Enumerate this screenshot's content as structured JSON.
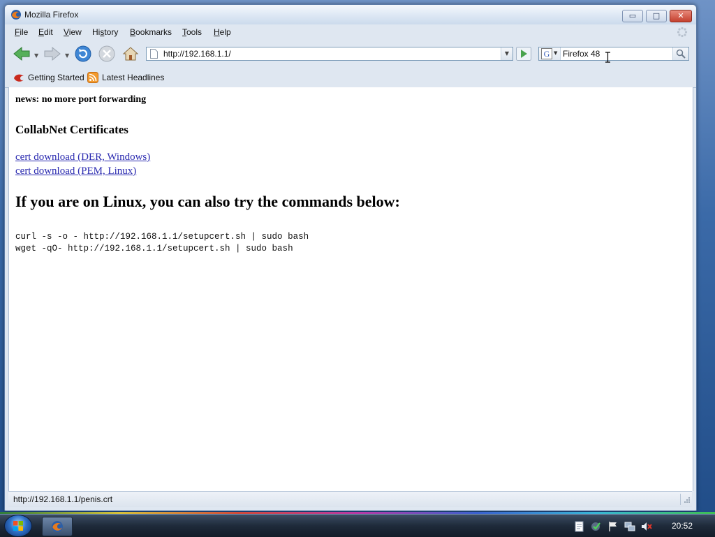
{
  "window": {
    "title": "Mozilla Firefox",
    "controls": {
      "minimize": "▭",
      "maximize": "□",
      "close": "✕"
    }
  },
  "menu": {
    "items": [
      {
        "pre": "",
        "key": "F",
        "post": "ile"
      },
      {
        "pre": "",
        "key": "E",
        "post": "dit"
      },
      {
        "pre": "",
        "key": "V",
        "post": "iew"
      },
      {
        "pre": "Hi",
        "key": "s",
        "post": "tory"
      },
      {
        "pre": "",
        "key": "B",
        "post": "ookmarks"
      },
      {
        "pre": "",
        "key": "T",
        "post": "ools"
      },
      {
        "pre": "",
        "key": "H",
        "post": "elp"
      }
    ]
  },
  "navigation": {
    "url": "http://192.168.1.1/",
    "search_value": "Firefox 48"
  },
  "bookmarks": {
    "items": [
      "Getting Started",
      "Latest Headlines"
    ]
  },
  "page": {
    "news": "news: no more port forwarding",
    "heading_certs": "CollabNet Certificates",
    "link_der": "cert download (DER, Windows)",
    "link_pem": "cert download (PEM, Linux)",
    "heading_linux": "If you are on Linux, you can also try the commands below:",
    "cmd_curl": "curl -s -o - http://192.168.1.1/setupcert.sh | sudo bash",
    "cmd_wget": "wget -qO- http://192.168.1.1/setupcert.sh | sudo bash"
  },
  "status": {
    "text": "http://192.168.1.1/penis.crt"
  },
  "taskbar": {
    "clock": "20:52"
  },
  "colors": {
    "link": "#2a2ab0",
    "titlebar": "#dfe9f5",
    "taskbar": "#1e2a3a"
  }
}
